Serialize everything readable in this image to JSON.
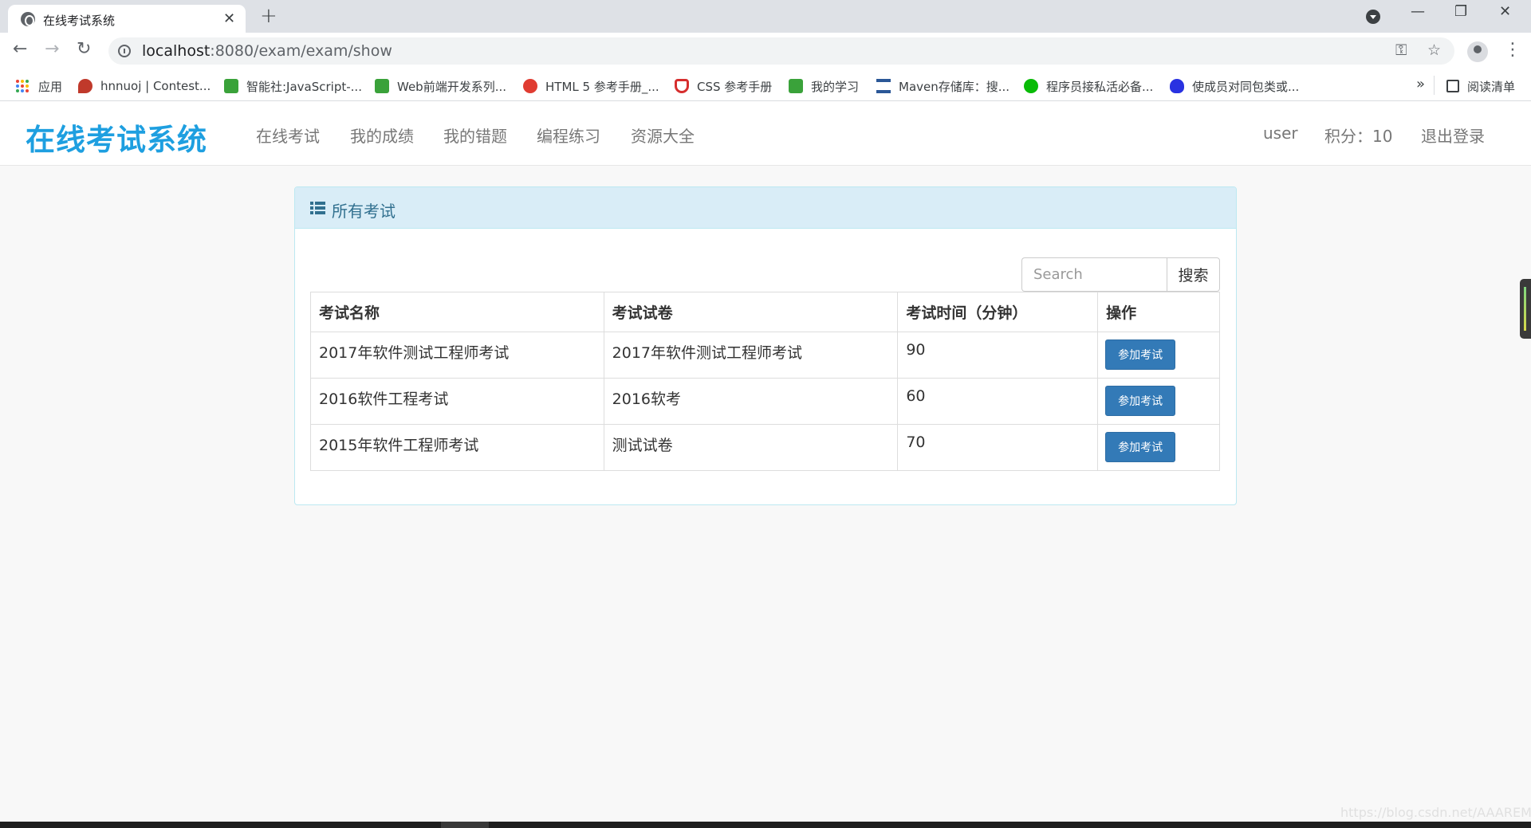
{
  "browser": {
    "tab_title": "在线考试系统",
    "tab_close": "✕",
    "new_tab": "+",
    "url_host": "localhost",
    "url_rest": ":8080/exam/exam/show",
    "window_controls": {
      "minimize": "—",
      "restore": "❐",
      "close": "✕"
    },
    "nav": {
      "back": "←",
      "forward": "→",
      "reload": "↻"
    },
    "omnibox_icons": {
      "key": "⚿",
      "star": "☆"
    },
    "kebab": "⋮",
    "bookmarks": [
      {
        "label": "应用",
        "icon": "apps-grid-icon"
      },
      {
        "label": "hnnuoj | Contest...",
        "icon": "balloon-icon",
        "color": "#c0392b"
      },
      {
        "label": "智能社:JavaScript-...",
        "icon": "green-book-icon",
        "color": "#3aa23a"
      },
      {
        "label": "Web前端开发系列...",
        "icon": "green-book-icon",
        "color": "#3aa23a"
      },
      {
        "label": "HTML 5 参考手册_...",
        "icon": "owl-icon",
        "color": "#e03c31"
      },
      {
        "label": "CSS 参考手册",
        "icon": "css-shield-icon",
        "color": "#d62e2e"
      },
      {
        "label": "我的学习",
        "icon": "green-book-icon",
        "color": "#3aa23a"
      },
      {
        "label": "Maven存储库：搜...",
        "icon": "mvn-icon",
        "color": "#2b5797"
      },
      {
        "label": "程序员接私活必备...",
        "icon": "wechat-icon",
        "color": "#09bb07"
      },
      {
        "label": "使成员对同包类或...",
        "icon": "baidu-paw-icon",
        "color": "#2932e1"
      }
    ],
    "bookmarks_more": "»",
    "reading_list": "阅读清单"
  },
  "navbar": {
    "brand": "在线考试系统",
    "links": [
      "在线考试",
      "我的成绩",
      "我的错题",
      "编程练习",
      "资源大全"
    ],
    "user": "user",
    "points": "积分：10",
    "logout": "退出登录"
  },
  "panel": {
    "title": "所有考试",
    "search": {
      "placeholder": "Search",
      "button": "搜索"
    },
    "table": {
      "headers": [
        "考试名称",
        "考试试卷",
        "考试时间（分钟）",
        "操作"
      ],
      "rows": [
        {
          "name": "2017年软件测试工程师考试",
          "paper": "2017年软件测试工程师考试",
          "minutes": "90",
          "action": "参加考试"
        },
        {
          "name": "2016软件工程考试",
          "paper": "2016软考",
          "minutes": "60",
          "action": "参加考试"
        },
        {
          "name": "2015年软件工程师考试",
          "paper": "测试试卷",
          "minutes": "70",
          "action": "参加考试"
        }
      ]
    }
  },
  "watermark": "https://blog.csdn.net/AAAREMIX",
  "colors": {
    "brand": "#1e9fe0",
    "primary_button": "#337ab7",
    "panel_heading": "#d9edf7"
  }
}
